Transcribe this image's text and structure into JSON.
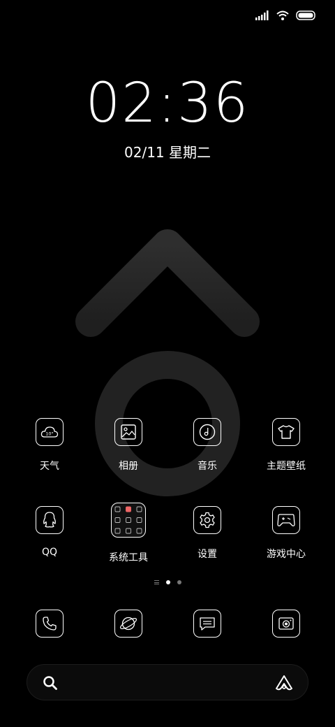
{
  "status_bar": {
    "signal_icon": "signal-icon",
    "wifi_icon": "wifi-icon",
    "battery_icon": "battery-icon"
  },
  "clock": {
    "time": "02:36",
    "date": "02/11 星期二"
  },
  "wallpaper": {
    "description_icon": "male-symbol-arrow-icon",
    "color": "#2a2a2a"
  },
  "apps_row1": [
    {
      "label": "天气",
      "icon": "weather-icon",
      "temp": "10°"
    },
    {
      "label": "相册",
      "icon": "gallery-icon"
    },
    {
      "label": "音乐",
      "icon": "music-icon"
    },
    {
      "label": "主题壁纸",
      "icon": "themes-icon"
    }
  ],
  "apps_row2": [
    {
      "label": "QQ",
      "icon": "qq-icon"
    },
    {
      "label": "系统工具",
      "icon": "system-tools-folder-icon"
    },
    {
      "label": "设置",
      "icon": "settings-icon"
    },
    {
      "label": "游戏中心",
      "icon": "game-center-icon"
    }
  ],
  "page_indicator": {
    "pages": 2,
    "current": 1
  },
  "dock": [
    {
      "icon": "phone-icon"
    },
    {
      "icon": "browser-icon"
    },
    {
      "icon": "messages-icon"
    },
    {
      "icon": "camera-icon"
    }
  ],
  "search_bar": {
    "search_icon": "search-icon",
    "assistant_icon": "assistant-icon"
  }
}
